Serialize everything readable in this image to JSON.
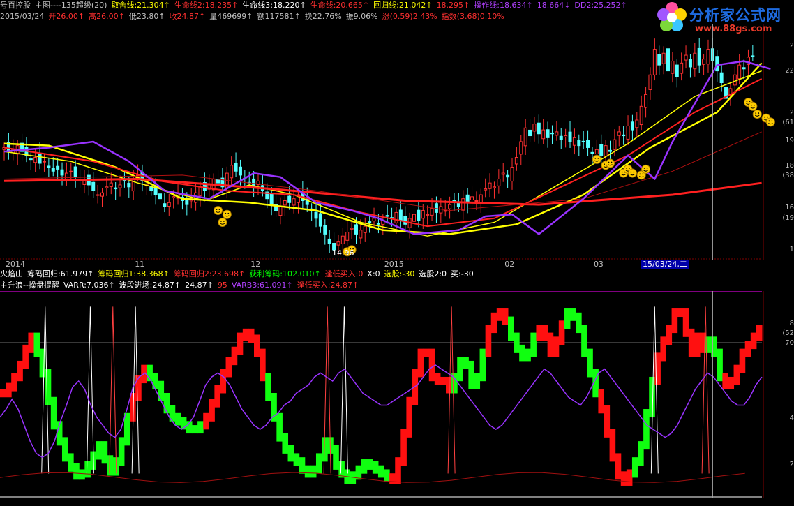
{
  "header": {
    "row1": [
      {
        "text": "号百控股",
        "color": "#c0c0c0"
      },
      {
        "text": "主图----135超级(20)",
        "color": "#c0c0c0"
      },
      {
        "text": "取舍线:21.304↑",
        "color": "#ffff00"
      },
      {
        "text": "生命线2:18.235↑",
        "color": "#ff3030"
      },
      {
        "text": "生命线3:18.220↑",
        "color": "#ffffff"
      },
      {
        "text": "生命线:20.665↑",
        "color": "#ff3030"
      },
      {
        "text": "回归线:21.042↑",
        "color": "#ffff00"
      },
      {
        "text": "18.295↑",
        "color": "#ff3030"
      },
      {
        "text": "操作线:18.634↑",
        "color": "#b040ff"
      },
      {
        "text": "18.664↓",
        "color": "#b040ff"
      },
      {
        "text": "DD2:25.252↑",
        "color": "#b040ff"
      }
    ],
    "row2": [
      {
        "text": "2015/03/24",
        "color": "#c0c0c0"
      },
      {
        "text": "开26.00↑",
        "color": "#ff3030"
      },
      {
        "text": "高26.00↑",
        "color": "#ff3030"
      },
      {
        "text": "低23.80↑",
        "color": "#c0c0c0"
      },
      {
        "text": "收24.87↑",
        "color": "#ff3030"
      },
      {
        "text": "量469699↑",
        "color": "#c0c0c0"
      },
      {
        "text": "额117581↑",
        "color": "#c0c0c0"
      },
      {
        "text": "换22.76%",
        "color": "#c0c0c0"
      },
      {
        "text": "振9.06%",
        "color": "#c0c0c0"
      },
      {
        "text": "涨(0.59)2.43%",
        "color": "#ff3030"
      },
      {
        "text": "指数(3.68)0.10%",
        "color": "#ff3030"
      }
    ],
    "row3": [
      {
        "text": "火焰山",
        "color": "#ffffff"
      },
      {
        "text": "筹码回归:61.979↑",
        "color": "#ffffff"
      },
      {
        "text": "筹码回归1:38.368↑",
        "color": "#ffff00"
      },
      {
        "text": "筹码回归2:23.698↑",
        "color": "#ff3030"
      },
      {
        "text": "获利筹码:102.010↑",
        "color": "#00ff00"
      },
      {
        "text": "逢低买入:0",
        "color": "#ff3030"
      },
      {
        "text": "X:0",
        "color": "#ffffff"
      },
      {
        "text": "选股:-30",
        "color": "#ffff00"
      },
      {
        "text": "选股2:0",
        "color": "#ffffff"
      },
      {
        "text": "买:-30",
        "color": "#ffffff"
      }
    ],
    "row4": [
      {
        "text": "主升浪--操盘提醒",
        "color": "#ffffff"
      },
      {
        "text": "VARR:7.036↑",
        "color": "#ffffff"
      },
      {
        "text": "波段进场:24.87↑",
        "color": "#ffffff"
      },
      {
        "text": "24.87↑",
        "color": "#ffffff"
      },
      {
        "text": "95",
        "color": "#ff3030"
      },
      {
        "text": "VARB3:61.091↑",
        "color": "#b040ff"
      },
      {
        "text": "逢低买入:24.87↑",
        "color": "#ff3030"
      }
    ]
  },
  "logo": {
    "title": "分析家公式网",
    "url": "www.88gs.com"
  },
  "cursor_date": "15/03/24,二",
  "min_label": "14.96",
  "axis": {
    "x_ticks": [
      {
        "label": "2014",
        "idx": 0
      },
      {
        "label": "11",
        "idx": 29
      },
      {
        "label": "12",
        "idx": 55
      },
      {
        "label": "2015",
        "idx": 85
      },
      {
        "label": "02",
        "idx": 112
      },
      {
        "label": "03",
        "idx": 132
      }
    ],
    "y_ticks_main": [
      "2",
      "22",
      "2",
      "(61",
      "19",
      "18",
      "(38",
      "16",
      "(19",
      "1"
    ],
    "y_ticks_sub": [
      "8",
      "(52",
      "70",
      "4",
      "2"
    ]
  },
  "chart_data": [
    {
      "type": "candlestick",
      "title": "号百控股 主图----135超级(20)",
      "ylim": [
        14.5,
        26.5
      ],
      "candles_close": [
        20.2,
        20.0,
        20.1,
        20.3,
        20.0,
        19.8,
        19.6,
        19.7,
        19.4,
        19.5,
        19.2,
        19.0,
        19.1,
        18.8,
        18.9,
        19.0,
        18.7,
        18.5,
        18.6,
        18.3,
        18.0,
        17.8,
        17.9,
        18.2,
        18.4,
        18.1,
        18.3,
        18.5,
        18.2,
        18.6,
        18.8,
        18.5,
        18.3,
        18.0,
        17.8,
        17.6,
        17.2,
        17.4,
        17.7,
        17.9,
        17.5,
        17.3,
        17.6,
        17.9,
        18.2,
        18.0,
        18.3,
        18.6,
        18.4,
        18.2,
        18.9,
        19.3,
        19.0,
        18.8,
        18.6,
        18.4,
        18.2,
        18.5,
        18.0,
        17.6,
        17.3,
        17.0,
        17.2,
        17.5,
        17.4,
        17.6,
        17.8,
        17.5,
        17.3,
        17.0,
        16.6,
        16.2,
        15.8,
        15.3,
        15.0,
        15.4,
        15.7,
        15.9,
        16.1,
        15.8,
        16.0,
        16.2,
        16.4,
        16.6,
        16.3,
        16.5,
        16.7,
        16.6,
        16.9,
        16.5,
        16.3,
        16.6,
        16.8,
        16.5,
        17.0,
        16.8,
        17.1,
        16.9,
        17.2,
        17.0,
        17.3,
        17.5,
        17.2,
        17.6,
        17.4,
        17.7,
        17.5,
        17.8,
        18.1,
        18.4,
        18.2,
        18.6,
        18.9,
        18.7,
        19.2,
        19.7,
        20.5,
        21.2,
        20.8,
        21.4,
        20.9,
        21.1,
        20.7,
        20.9,
        21.0,
        20.6,
        20.8,
        20.5,
        20.7,
        20.3,
        20.5,
        20.2,
        19.9,
        20.1,
        19.8,
        20.3,
        20.0,
        20.6,
        21.0,
        20.8,
        21.3,
        21.1,
        21.6,
        22.3,
        22.9,
        23.9,
        25.2,
        24.4,
        25.0,
        24.1,
        24.6,
        23.8,
        24.5,
        24.9,
        24.3,
        25.0,
        24.4,
        24.7,
        25.2,
        24.6,
        24.1,
        23.5,
        22.7,
        23.2,
        23.9,
        24.4,
        24.2,
        24.8,
        24.87
      ],
      "series": [
        {
          "name": "取舍线",
          "color": "#ffff00",
          "width": 2.5,
          "points": [
            [
              0,
              20.4
            ],
            [
              10,
              20.3
            ],
            [
              25,
              19.2
            ],
            [
              40,
              17.6
            ],
            [
              55,
              17.4
            ],
            [
              70,
              17.0
            ],
            [
              85,
              16.0
            ],
            [
              100,
              15.8
            ],
            [
              115,
              16.3
            ],
            [
              130,
              17.8
            ],
            [
              145,
              20.2
            ],
            [
              160,
              22.0
            ],
            [
              170,
              24.5
            ]
          ]
        },
        {
          "name": "回归线",
          "color": "#ffff00",
          "width": 1.5,
          "points": [
            [
              0,
              20.0
            ],
            [
              15,
              19.5
            ],
            [
              30,
              18.4
            ],
            [
              45,
              17.5
            ],
            [
              55,
              18.3
            ],
            [
              65,
              17.8
            ],
            [
              80,
              16.4
            ],
            [
              95,
              15.7
            ],
            [
              110,
              16.4
            ],
            [
              125,
              18.4
            ],
            [
              140,
              20.4
            ],
            [
              155,
              22.8
            ],
            [
              170,
              24.1
            ]
          ]
        },
        {
          "name": "生命线",
          "color": "#ff2020",
          "width": 2,
          "points": [
            [
              0,
              20.2
            ],
            [
              20,
              19.5
            ],
            [
              35,
              18.5
            ],
            [
              50,
              18.0
            ],
            [
              65,
              17.8
            ],
            [
              80,
              16.9
            ],
            [
              95,
              16.2
            ],
            [
              110,
              16.6
            ],
            [
              125,
              18.2
            ],
            [
              140,
              19.8
            ],
            [
              155,
              22.0
            ],
            [
              170,
              23.7
            ]
          ]
        },
        {
          "name": "生命线2",
          "color": "#ff2020",
          "width": 3,
          "points": [
            [
              0,
              18.5
            ],
            [
              30,
              18.6
            ],
            [
              60,
              18.1
            ],
            [
              90,
              17.5
            ],
            [
              120,
              17.3
            ],
            [
              150,
              17.8
            ],
            [
              170,
              18.4
            ]
          ]
        },
        {
          "name": "生命线3",
          "color": "#b01010",
          "width": 1,
          "points": [
            [
              0,
              18.6
            ],
            [
              40,
              18.8
            ],
            [
              70,
              18.0
            ],
            [
              100,
              17.0
            ],
            [
              130,
              17.6
            ],
            [
              150,
              19.0
            ],
            [
              170,
              21.0
            ]
          ]
        },
        {
          "name": "操作线",
          "color": "#9933ff",
          "width": 2.5,
          "points": [
            [
              0,
              20.0
            ],
            [
              10,
              20.2
            ],
            [
              20,
              20.5
            ],
            [
              28,
              19.5
            ],
            [
              36,
              18.0
            ],
            [
              46,
              17.6
            ],
            [
              56,
              18.9
            ],
            [
              62,
              18.7
            ],
            [
              70,
              17.4
            ],
            [
              78,
              17.0
            ],
            [
              84,
              16.6
            ],
            [
              92,
              15.8
            ],
            [
              102,
              16.0
            ],
            [
              108,
              16.7
            ],
            [
              114,
              16.8
            ],
            [
              120,
              15.8
            ],
            [
              130,
              17.6
            ],
            [
              140,
              19.8
            ],
            [
              146,
              18.6
            ],
            [
              150,
              20.5
            ],
            [
              160,
              24.4
            ],
            [
              166,
              24.6
            ],
            [
              172,
              24.2
            ]
          ]
        }
      ]
    },
    {
      "type": "bar",
      "title": "主升浪--操盘提醒",
      "ylim": [
        0,
        100
      ],
      "values": [
        52,
        55,
        60,
        66,
        74,
        80,
        72,
        62,
        48,
        36,
        28,
        20,
        15,
        11,
        12,
        16,
        21,
        26,
        19,
        13,
        18,
        28,
        40,
        50,
        59,
        64,
        60,
        56,
        50,
        44,
        40,
        38,
        36,
        34,
        34,
        36,
        40,
        47,
        54,
        62,
        68,
        73,
        80,
        82,
        79,
        72,
        60,
        50,
        40,
        30,
        24,
        20,
        18,
        14,
        12,
        14,
        20,
        28,
        24,
        16,
        12,
        9,
        11,
        14,
        17,
        16,
        14,
        12,
        10,
        9,
        18,
        32,
        48,
        62,
        72,
        72,
        60,
        58,
        58,
        54,
        60,
        68,
        66,
        56,
        60,
        72,
        84,
        90,
        92,
        88,
        80,
        74,
        70,
        72,
        80,
        84,
        80,
        72,
        78,
        86,
        92,
        90,
        84,
        72,
        62,
        52,
        44,
        32,
        20,
        11,
        8,
        12,
        18,
        26,
        42,
        58,
        70,
        78,
        84,
        92,
        92,
        82,
        72,
        80,
        74,
        78,
        72,
        60,
        56,
        58,
        64,
        72,
        76,
        80,
        84
      ],
      "colors": [
        "red",
        "red",
        "red",
        "red",
        "red",
        "red",
        "green",
        "green",
        "green",
        "green",
        "green",
        "green",
        "green",
        "green",
        "green",
        "green",
        "green",
        "green",
        "green",
        "green",
        "green",
        "green",
        "green",
        "red",
        "red",
        "red",
        "green",
        "green",
        "green",
        "green",
        "green",
        "green",
        "green",
        "green",
        "green",
        "green",
        "red",
        "red",
        "red",
        "red",
        "red",
        "red",
        "red",
        "red",
        "red",
        "red",
        "red",
        "green",
        "green",
        "green",
        "green",
        "green",
        "green",
        "green",
        "green",
        "green",
        "green",
        "green",
        "green",
        "green",
        "green",
        "green",
        "green",
        "green",
        "green",
        "green",
        "green",
        "green",
        "green",
        "red",
        "red",
        "red",
        "red",
        "red",
        "red",
        "red",
        "red",
        "red",
        "red",
        "red",
        "green",
        "green",
        "green",
        "green",
        "green",
        "green",
        "red",
        "red",
        "red",
        "red",
        "green",
        "green",
        "green",
        "green",
        "green",
        "red",
        "red",
        "red",
        "red",
        "red",
        "green",
        "green",
        "green",
        "green",
        "green",
        "green",
        "red",
        "red",
        "red",
        "red",
        "red",
        "red",
        "green",
        "green",
        "green",
        "green",
        "red",
        "red",
        "red",
        "red",
        "red",
        "red",
        "red",
        "red",
        "red",
        "green",
        "green",
        "green",
        "red",
        "red",
        "red",
        "red",
        "red",
        "red",
        "red",
        "red"
      ],
      "series": [
        {
          "name": "VARB3",
          "color": "#9933ff",
          "values": [
            40,
            44,
            49,
            44,
            36,
            28,
            22,
            20,
            22,
            28,
            38,
            46,
            55,
            58,
            54,
            46,
            40,
            36,
            32,
            30,
            34,
            44,
            55,
            60,
            62,
            58,
            52,
            46,
            40,
            36,
            34,
            36,
            40,
            48,
            56,
            60,
            62,
            60,
            56,
            50,
            44,
            40,
            36,
            34,
            36,
            40,
            42,
            46,
            48,
            52,
            54,
            56,
            60,
            62,
            60,
            58,
            62,
            64,
            60,
            56,
            52,
            50,
            48,
            46,
            46,
            48,
            50,
            52,
            54,
            56,
            60,
            64,
            66,
            64,
            62,
            60,
            56,
            52,
            48,
            44,
            40,
            36,
            34,
            36,
            40,
            44,
            48,
            52,
            56,
            60,
            64,
            62,
            58,
            54,
            50,
            48,
            46,
            50,
            56,
            62,
            64,
            60,
            56,
            52,
            48,
            44,
            40,
            36,
            34,
            32,
            30,
            32,
            36,
            42,
            48,
            54,
            58,
            62,
            60,
            56,
            52,
            48,
            46,
            46,
            50,
            56,
            60
          ]
        }
      ]
    }
  ]
}
